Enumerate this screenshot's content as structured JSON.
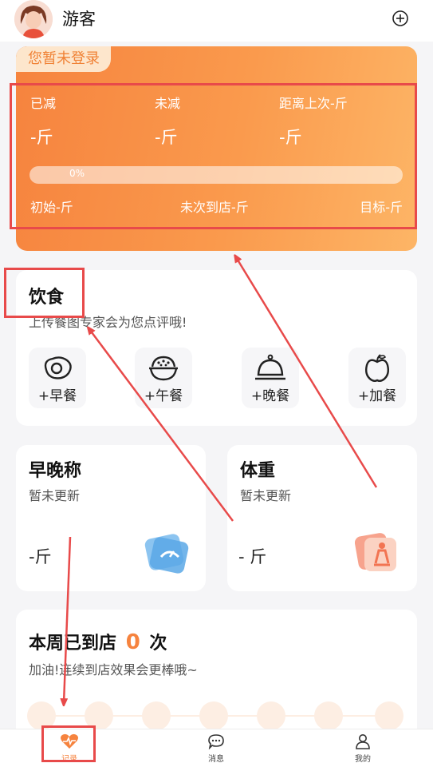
{
  "header": {
    "username": "游客",
    "avatar_icon": "avatar-girl-icon",
    "add_icon": "plus-circle-icon"
  },
  "summary_card": {
    "login_tag": "您暂未登录",
    "stats": [
      {
        "label": "已减",
        "value": "-斤"
      },
      {
        "label": "未减",
        "value": "-斤"
      },
      {
        "label": "距离上次-斤",
        "value": "-斤"
      }
    ],
    "progress": {
      "text": "0%",
      "fraction": 0.0
    },
    "footer": {
      "initial": "初始-斤",
      "last_visit": "未次到店-斤",
      "target": "目标-斤"
    }
  },
  "diet": {
    "title": "饮食",
    "subtitle": "上传餐图专家会为您点评哦!",
    "meals": [
      {
        "label": "+早餐",
        "icon": "fried-egg-icon"
      },
      {
        "label": "+午餐",
        "icon": "rice-bowl-icon"
      },
      {
        "label": "+晚餐",
        "icon": "dinner-cloche-icon"
      },
      {
        "label": "+加餐",
        "icon": "apple-icon"
      }
    ]
  },
  "morning_evening": {
    "title": "早晚称",
    "subtitle": "暂未更新",
    "value": "-斤",
    "icon": "scale-icon"
  },
  "weight": {
    "title": "体重",
    "subtitle": "暂未更新",
    "value": "- 斤",
    "icon": "body-weight-icon"
  },
  "weekly": {
    "title_prefix": "本周已到店",
    "count": "0",
    "title_suffix": "次",
    "subtitle": "加油!连续到店效果会更棒哦~"
  },
  "tabbar": {
    "tabs": [
      {
        "label": "记录",
        "icon": "heart-pulse-icon",
        "active": true
      },
      {
        "label": "消息",
        "icon": "message-icon",
        "active": false
      },
      {
        "label": "我的",
        "icon": "user-icon",
        "active": false
      }
    ]
  },
  "colors": {
    "accent": "#f6833e",
    "annotation": "#e84a4a"
  }
}
